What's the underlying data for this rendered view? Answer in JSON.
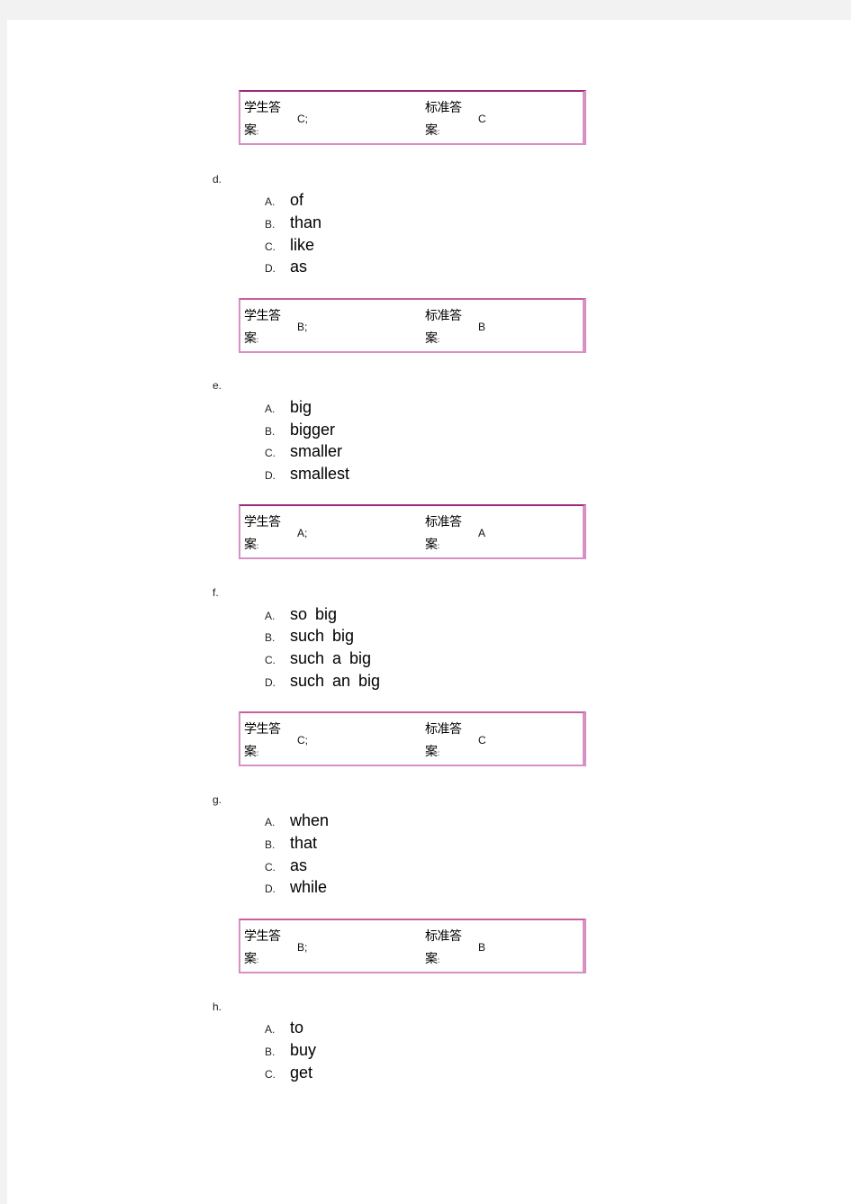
{
  "answer_labels": {
    "student": "学生答案",
    "student_line1": "学生答",
    "student_line2": "案",
    "standard_line1": "标准答",
    "standard_line2": "案",
    "colon": ":"
  },
  "questions": [
    {
      "id": "c",
      "label": "",
      "options": [],
      "student_answer": "C;",
      "standard_answer": "C"
    },
    {
      "id": "d",
      "label": "d.",
      "options": [
        {
          "letter": "A.",
          "text": "of"
        },
        {
          "letter": "B.",
          "text": "than"
        },
        {
          "letter": "C.",
          "text": "like"
        },
        {
          "letter": "D.",
          "text": "as"
        }
      ],
      "student_answer": "B;",
      "standard_answer": "B"
    },
    {
      "id": "e",
      "label": "e.",
      "options": [
        {
          "letter": "A.",
          "text": "big"
        },
        {
          "letter": "B.",
          "text": "bigger"
        },
        {
          "letter": "C.",
          "text": "smaller"
        },
        {
          "letter": "D.",
          "text": "smallest"
        }
      ],
      "student_answer": "A;",
      "standard_answer": "A"
    },
    {
      "id": "f",
      "label": "f.",
      "options": [
        {
          "letter": "A.",
          "text": "so big"
        },
        {
          "letter": "B.",
          "text": "such big"
        },
        {
          "letter": "C.",
          "text": "such a big"
        },
        {
          "letter": "D.",
          "text": "such an big"
        }
      ],
      "student_answer": "C;",
      "standard_answer": "C"
    },
    {
      "id": "g",
      "label": "g.",
      "options": [
        {
          "letter": "A.",
          "text": "when"
        },
        {
          "letter": "B.",
          "text": "that"
        },
        {
          "letter": "C.",
          "text": "as"
        },
        {
          "letter": "D.",
          "text": "while"
        }
      ],
      "student_answer": "B;",
      "standard_answer": "B"
    },
    {
      "id": "h",
      "label": "h.",
      "options": [
        {
          "letter": "A.",
          "text": "to"
        },
        {
          "letter": "B.",
          "text": "buy"
        },
        {
          "letter": "C.",
          "text": "get"
        }
      ]
    }
  ],
  "colors": {
    "border_top_dark": "#a0287a",
    "border_side": "#d690c4",
    "page_background": "#f2f2f2"
  }
}
